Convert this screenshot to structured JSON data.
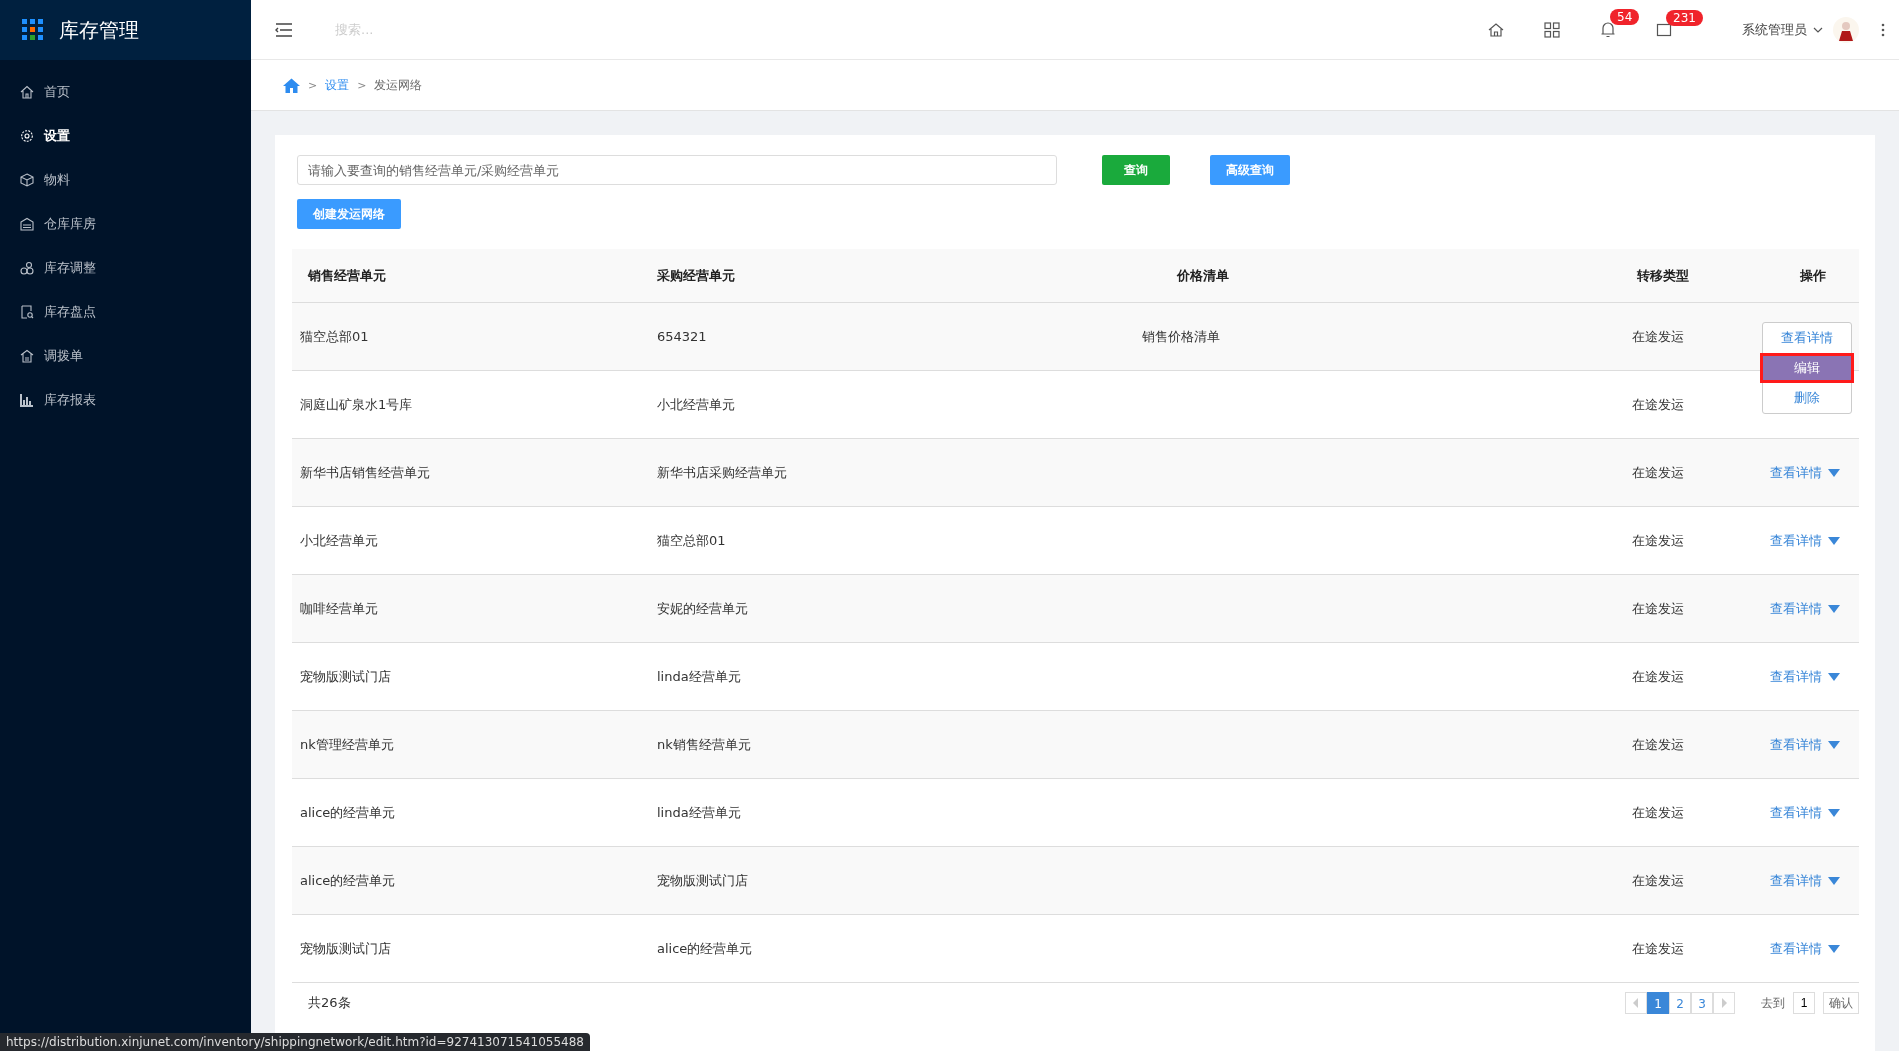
{
  "app": {
    "title": "库存管理"
  },
  "sidebar": {
    "items": [
      {
        "label": "首页",
        "selected": false
      },
      {
        "label": "设置",
        "selected": true
      },
      {
        "label": "物料",
        "selected": false
      },
      {
        "label": "仓库库房",
        "selected": false
      },
      {
        "label": "库存调整",
        "selected": false
      },
      {
        "label": "库存盘点",
        "selected": false
      },
      {
        "label": "调拨单",
        "selected": false
      },
      {
        "label": "库存报表",
        "selected": false
      }
    ]
  },
  "header": {
    "search_placeholder": "搜索...",
    "notifications": "54",
    "messages": "231",
    "user": "系统管理员"
  },
  "breadcrumb": [
    {
      "separator": ">",
      "label": "设置",
      "link": true
    },
    {
      "separator": ">",
      "label": "发运网络",
      "link": false
    }
  ],
  "query": {
    "placeholder": "请输入要查询的销售经营单元/采购经营单元",
    "search_button": "查询",
    "advanced_button": "高级查询",
    "create_button": "创建发运网络"
  },
  "table": {
    "columns": [
      "销售经营单元",
      "采购经营单元",
      "价格清单",
      "转移类型",
      "操作"
    ],
    "rows": [
      {
        "sales": "猫空总部01",
        "purchase": "654321",
        "price_list": "销售价格清单",
        "transfer": "在途发运",
        "expanded": true,
        "menu": [
          {
            "label": "查看详情",
            "selected": false
          },
          {
            "label": "编辑",
            "selected": true
          },
          {
            "label": "删除",
            "selected": false
          }
        ]
      },
      {
        "sales": "洞庭山矿泉水1号库",
        "purchase": "小北经营单元",
        "transfer": "在途发运"
      },
      {
        "sales": "新华书店销售经营单元",
        "purchase": "新华书店采购经营单元",
        "transfer": "在途发运",
        "action": "查看详情",
        "expanded": false
      },
      {
        "sales": "小北经营单元",
        "purchase": "猫空总部01",
        "transfer": "在途发运",
        "action": "查看详情",
        "expanded": false
      },
      {
        "sales": "咖啡经营单元",
        "purchase": "安妮的经营单元",
        "transfer": "在途发运",
        "action": "查看详情",
        "expanded": false
      },
      {
        "sales": "宠物版测试门店",
        "purchase": "linda经营单元",
        "transfer": "在途发运",
        "action": "查看详情",
        "expanded": false
      },
      {
        "sales": "nk管理经营单元",
        "purchase": "nk销售经营单元",
        "transfer": "在途发运",
        "action": "查看详情",
        "expanded": false
      },
      {
        "sales": "alice的经营单元",
        "purchase": "linda经营单元",
        "transfer": "在途发运",
        "action": "查看详情",
        "expanded": false
      },
      {
        "sales": "alice的经营单元",
        "purchase": "宠物版测试门店",
        "transfer": "在途发运",
        "action": "查看详情",
        "expanded": false
      },
      {
        "sales": "宠物版测试门店",
        "purchase": "alice的经营单元",
        "transfer": "在途发运",
        "action": "查看详情",
        "expanded": false
      }
    ]
  },
  "footer": {
    "total": "共26条",
    "pages": [
      {
        "label": "1",
        "selected": true
      },
      {
        "label": "2",
        "selected": false
      },
      {
        "label": "3",
        "selected": false
      }
    ],
    "goto_label": "去到",
    "goto_value": "1",
    "confirm": "确认"
  },
  "status_bar": {
    "url": "https://distribution.xinjunet.com/inventory/shippingnetwork/edit.htm?id=927413071541055488"
  }
}
